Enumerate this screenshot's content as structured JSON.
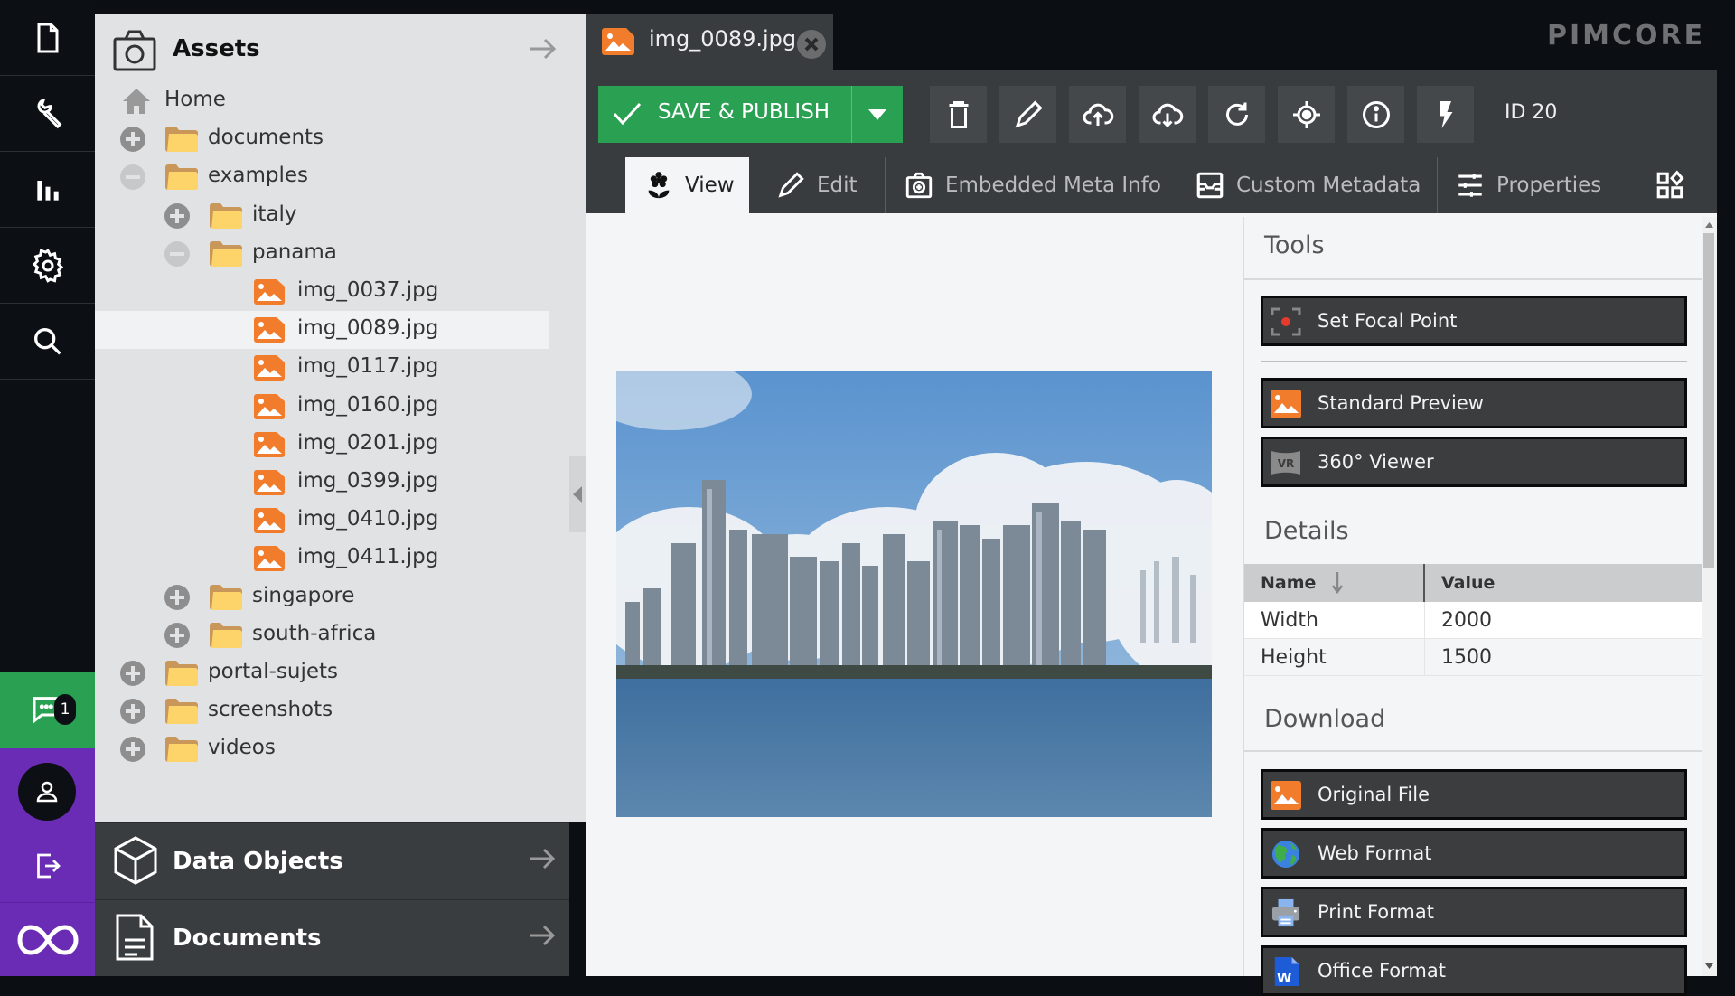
{
  "nav": {
    "items": [
      {
        "name": "documents",
        "icon": "file-icon"
      },
      {
        "name": "tools",
        "icon": "wrench-icon"
      },
      {
        "name": "marketing",
        "icon": "bar-chart-icon"
      },
      {
        "name": "settings",
        "icon": "gear-icon"
      },
      {
        "name": "search",
        "icon": "search-icon"
      }
    ],
    "notifications_count": "1",
    "colors": {
      "chat": "#2aa052",
      "user": "#6a2bb5"
    }
  },
  "tree": {
    "title": "Assets",
    "items": [
      {
        "label": "Home",
        "type": "home",
        "depth": 0
      },
      {
        "label": "documents",
        "type": "folder",
        "depth": 0,
        "toggle": "plus"
      },
      {
        "label": "examples",
        "type": "folder",
        "depth": 0,
        "toggle": "minus"
      },
      {
        "label": "italy",
        "type": "folder",
        "depth": 1,
        "toggle": "plus"
      },
      {
        "label": "panama",
        "type": "folder",
        "depth": 1,
        "toggle": "minus"
      },
      {
        "label": "img_0037.jpg",
        "type": "image",
        "depth": 2
      },
      {
        "label": "img_0089.jpg",
        "type": "image",
        "depth": 2,
        "selected": true
      },
      {
        "label": "img_0117.jpg",
        "type": "image",
        "depth": 2
      },
      {
        "label": "img_0160.jpg",
        "type": "image",
        "depth": 2
      },
      {
        "label": "img_0201.jpg",
        "type": "image",
        "depth": 2
      },
      {
        "label": "img_0399.jpg",
        "type": "image",
        "depth": 2
      },
      {
        "label": "img_0410.jpg",
        "type": "image",
        "depth": 2
      },
      {
        "label": "img_0411.jpg",
        "type": "image",
        "depth": 2
      },
      {
        "label": "singapore",
        "type": "folder",
        "depth": 1,
        "toggle": "plus"
      },
      {
        "label": "south-africa",
        "type": "folder",
        "depth": 1,
        "toggle": "plus"
      },
      {
        "label": "portal-sujets",
        "type": "folder",
        "depth": 0,
        "toggle": "plus"
      },
      {
        "label": "screenshots",
        "type": "folder",
        "depth": 0,
        "toggle": "plus"
      },
      {
        "label": "videos",
        "type": "folder",
        "depth": 0,
        "toggle": "plus"
      }
    ]
  },
  "accordion": {
    "data_objects": "Data Objects",
    "documents": "Documents"
  },
  "tab": {
    "title": "img_0089.jpg"
  },
  "brand": {
    "logo": "PIMCORE"
  },
  "toolbar": {
    "save_label": "SAVE & PUBLISH",
    "buttons": [
      "delete",
      "rename",
      "upload",
      "download",
      "reload",
      "locate-in-tree",
      "info",
      "workflow"
    ],
    "id_label": "ID 20",
    "accent": "#2aa052"
  },
  "editor_tabs": [
    {
      "label": "View",
      "active": true
    },
    {
      "label": "Edit"
    },
    {
      "label": "Embedded Meta Info"
    },
    {
      "label": "Custom Metadata"
    },
    {
      "label": "Properties"
    },
    {
      "label": ""
    }
  ],
  "sidebar": {
    "tools_title": "Tools",
    "tools": [
      {
        "label": "Set Focal Point",
        "icon": "focal-point-icon"
      },
      {
        "label": "Standard Preview",
        "icon": "image-icon"
      },
      {
        "label": "360° Viewer",
        "icon": "vr-icon"
      }
    ],
    "details_title": "Details",
    "details_columns": [
      "Name",
      "Value"
    ],
    "details_rows": [
      {
        "name": "Width",
        "value": "2000"
      },
      {
        "name": "Height",
        "value": "1500"
      }
    ],
    "download_title": "Download",
    "downloads": [
      {
        "label": "Original File",
        "icon": "image-icon"
      },
      {
        "label": "Web Format",
        "icon": "globe-icon"
      },
      {
        "label": "Print Format",
        "icon": "printer-icon"
      },
      {
        "label": "Office Format",
        "icon": "word-icon"
      }
    ]
  }
}
